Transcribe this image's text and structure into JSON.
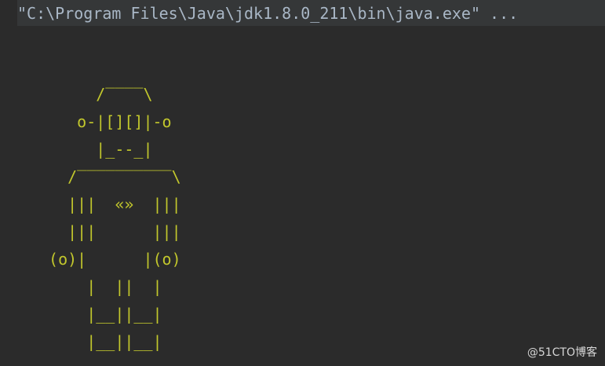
{
  "console": {
    "command": "\"C:\\Program Files\\Java\\jdk1.8.0_211\\bin\\java.exe\" ...",
    "output_lines": [
      "      /‾‾‾‾\\",
      "    o-|[][]|-o",
      "      |_--_|",
      "   /‾‾‾‾‾‾‾‾‾‾\\",
      "   |||  «»  |||",
      "   |||      |||",
      " (o)|      |(o)",
      "     |  ||  |",
      "     |__||__|",
      "     |__||__|"
    ]
  },
  "watermark": {
    "text": "@51CTO博客"
  },
  "colors": {
    "background": "#2b2b2b",
    "command_bar": "#353738",
    "command_text": "#a9b7c6",
    "output_text": "#c2c72c"
  }
}
